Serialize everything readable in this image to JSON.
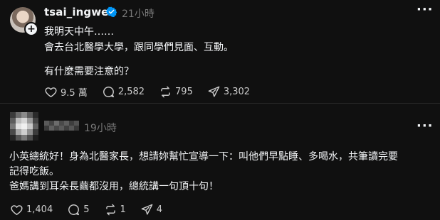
{
  "post1": {
    "username": "tsai_ingwen",
    "timestamp": "21小時",
    "more_icon": "more-icon",
    "lines": [
      "我明天中午……",
      "會去台北醫學大學，跟同學們見面、互動。",
      "有什麼需要注意的？"
    ],
    "actions": {
      "like_count": "9.5 萬",
      "reply_count": "2,582",
      "repost_count": "795",
      "share_count": "3,302"
    }
  },
  "post2": {
    "timestamp": "19小時",
    "lines": [
      "小英總統好！身為北醫家長，想請妳幫忙宣導一下：叫他們早點睡、多喝水，共筆讀完要",
      "記得吃飯。",
      "爸媽講到耳朵長繭都沒用，總統講一句頂十句！"
    ],
    "actions": {
      "like_count": "1,404",
      "reply_count": "5",
      "repost_count": "1",
      "share_count": "4"
    }
  },
  "colors": {
    "background": "#101010",
    "text": "#f3f5f7",
    "muted": "#777777",
    "verified": "#0095f6"
  }
}
